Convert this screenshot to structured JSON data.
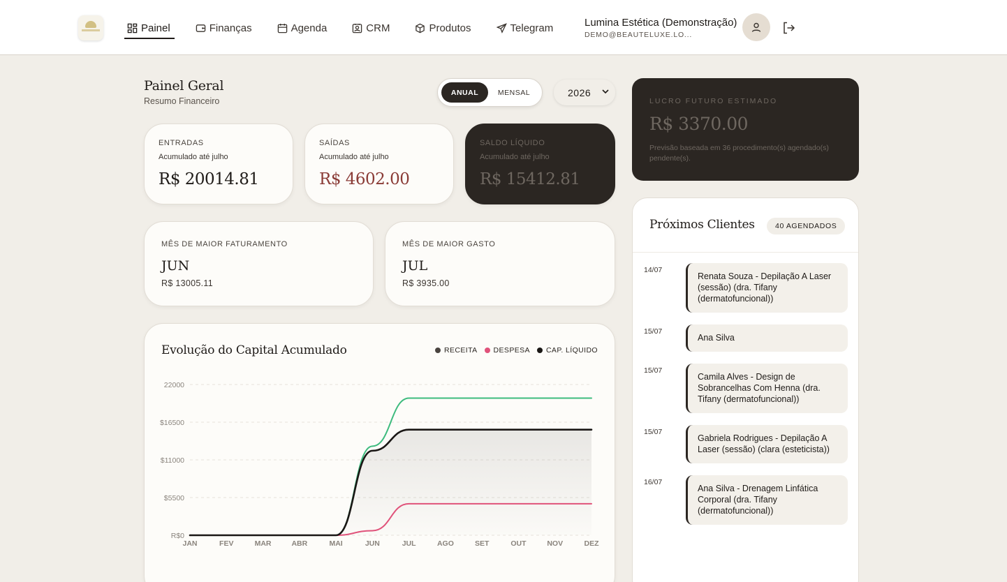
{
  "nav": {
    "items": [
      {
        "label": "Painel",
        "icon": "dashboard-icon"
      },
      {
        "label": "Finanças",
        "icon": "wallet-icon"
      },
      {
        "label": "Agenda",
        "icon": "calendar-icon"
      },
      {
        "label": "CRM",
        "icon": "contact-icon"
      },
      {
        "label": "Produtos",
        "icon": "box-icon"
      },
      {
        "label": "Telegram",
        "icon": "send-icon"
      }
    ],
    "active": "Painel"
  },
  "user": {
    "name": "Lumina Estética (Demonstração)",
    "email": "DEMO@BEAUTELUXE.LO..."
  },
  "header": {
    "title": "Painel Geral",
    "subtitle": "Resumo Financeiro"
  },
  "period_toggle": {
    "options": [
      "ANUAL",
      "MENSAL"
    ],
    "selected": "ANUAL"
  },
  "year_select": {
    "value": "2026"
  },
  "stats": {
    "entradas": {
      "label": "ENTRADAS",
      "sub": "Acumulado até julho",
      "value": "R$ 20014.81"
    },
    "saidas": {
      "label": "SAÍDAS",
      "sub": "Acumulado até julho",
      "value": "R$ 4602.00"
    },
    "saldo": {
      "label": "SALDO LÍQUIDO",
      "sub": "Acumulado até julho",
      "value": "R$ 15412.81"
    }
  },
  "highlights": {
    "best_revenue": {
      "label": "MÊS DE MAIOR FATURAMENTO",
      "month": "JUN",
      "amount": "R$ 13005.11"
    },
    "best_expense": {
      "label": "MÊS DE MAIOR GASTO",
      "month": "JUL",
      "amount": "R$ 3935.00"
    }
  },
  "profit": {
    "label": "LUCRO FUTURO ESTIMADO",
    "value": "R$ 3370.00",
    "note": "Previsão baseada em 36 procedimento(s) agendado(s) pendente(s)."
  },
  "clients": {
    "title": "Próximos Clientes",
    "badge": "40 AGENDADOS",
    "appointments": [
      {
        "date": "14/07",
        "text": "Renata Souza - Depilação A Laser (sessão) (dra. Tifany (dermatofuncional))"
      },
      {
        "date": "15/07",
        "text": "Ana Silva"
      },
      {
        "date": "15/07",
        "text": "Camila Alves - Design de Sobrancelhas Com Henna (dra. Tifany (dermatofuncional))"
      },
      {
        "date": "15/07",
        "text": "Gabriela Rodrigues - Depilação A Laser (sessão) (clara (esteticista))"
      },
      {
        "date": "16/07",
        "text": "Ana Silva - Drenagem Linfática Corporal (dra. Tifany (dermatofuncional))"
      }
    ]
  },
  "colors": {
    "receita": "#3dbb7e",
    "despesa": "#e0527a",
    "liquido": "#1a1715",
    "dark_card": "#2b2622"
  },
  "chart_data": {
    "type": "line",
    "title": "Evolução do Capital Acumulado",
    "categories": [
      "JAN",
      "FEV",
      "MAR",
      "ABR",
      "MAI",
      "JUN",
      "JUL",
      "AGO",
      "SET",
      "OUT",
      "NOV",
      "DEZ"
    ],
    "y_tick_labels": [
      "R$0",
      "$5500",
      "$11000",
      "$16500",
      "22000"
    ],
    "ylim": [
      0,
      22000
    ],
    "y_ticks": [
      0,
      5500,
      11000,
      16500,
      22000
    ],
    "legend_position": "top-right",
    "series": [
      {
        "name": "RECEITA",
        "values": [
          0,
          0,
          0,
          0,
          0,
          13005,
          20015,
          20015,
          20015,
          20015,
          20015,
          20015
        ]
      },
      {
        "name": "DESPESA",
        "values": [
          0,
          0,
          0,
          0,
          0,
          667,
          4602,
          4602,
          4602,
          4602,
          4602,
          4602
        ]
      },
      {
        "name": "CAP. LÍQUIDO",
        "values": [
          0,
          0,
          0,
          0,
          0,
          12338,
          15413,
          15413,
          15413,
          15413,
          15413,
          15413
        ]
      }
    ]
  }
}
